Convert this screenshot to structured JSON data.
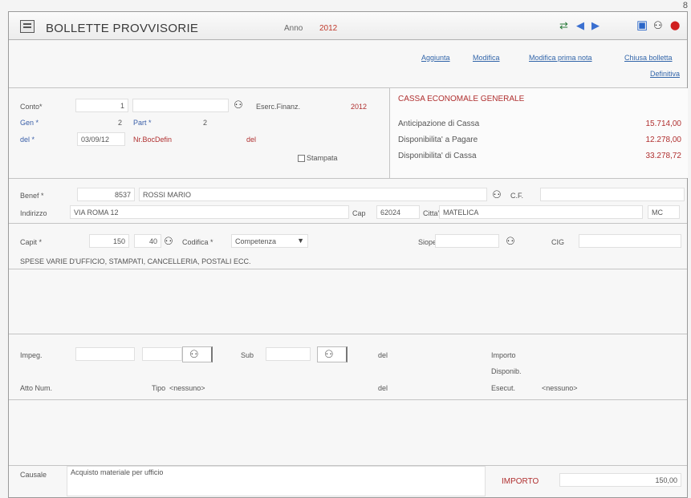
{
  "page_number": "8",
  "title": "BOLLETTE PROVVISORIE",
  "anno": {
    "label": "Anno",
    "value": "2012"
  },
  "toolbar_icons": [
    "print-icon",
    "arrow-left-icon",
    "arrow-right-icon",
    "save-icon",
    "binoculars-icon",
    "close-icon"
  ],
  "actions": {
    "aggiunta": "Aggiunta",
    "modifica": "Modifica",
    "modifica_prima_nota": "Modifica prima nota",
    "chiudi_bolletta": "Chiusa bolletta",
    "definitiva": "Definitiva"
  },
  "conto": {
    "label": "Conto*",
    "value": "1",
    "desc": "",
    "eserc_label": "Eserc.Finanz.",
    "eserc_value": "2012"
  },
  "gen": {
    "label": "Gen *",
    "value": "2",
    "part_label": "Part *",
    "part_value": "2"
  },
  "del": {
    "label": "del *",
    "value": "03/09/12",
    "nr_label": "Nr.BocDefin",
    "del2_label": "del"
  },
  "stampata": {
    "label": "Stampata"
  },
  "cassa": {
    "title": "CASSA ECONOMALE GENERALE",
    "rows": [
      {
        "label": "Anticipazione di Cassa",
        "value": "15.714,00"
      },
      {
        "label": "Disponibilita' a Pagare",
        "value": "12.278,00"
      },
      {
        "label": "Disponibilita' di Cassa",
        "value": "33.278,72"
      }
    ]
  },
  "benef": {
    "label": "Benef *",
    "code": "8537",
    "name": "ROSSI MARIO",
    "cf_label": "C.F."
  },
  "indirizzo": {
    "label": "Indirizzo",
    "value": "VIA ROMA 12",
    "cap_label": "Cap",
    "cap_value": "62024",
    "citta_label": "Citta'",
    "citta_value": "MATELICA",
    "prov": "MC"
  },
  "capit": {
    "label": "Capit *",
    "value": "150",
    "art": "40",
    "codifica_label": "Codifica *",
    "codifica_value": "Competenza",
    "siope_label": "Siope",
    "cig_label": "CIG"
  },
  "capitolo_desc": "SPESE VARIE D'UFFICIO, STAMPATI, CANCELLERIA, POSTALI ECC.",
  "impegno": {
    "label": "Impeg.",
    "sub_label": "Sub",
    "del_label": "del",
    "importo_label": "Importo",
    "disponib_label": "Disponib."
  },
  "atto": {
    "label": "Atto Num.",
    "tipo_label": "Tipo",
    "tipo_value": "<nessuno>",
    "del_label": "del",
    "esecut_label": "Esecut.",
    "esecut_value": "<nessuno>"
  },
  "causale": {
    "label": "Causale",
    "value": "Acquisto materiale per ufficio"
  },
  "importo": {
    "label": "IMPORTO",
    "value": "150,00"
  },
  "colors": {
    "accent_red": "#c0392b",
    "link_blue": "#3366aa"
  }
}
